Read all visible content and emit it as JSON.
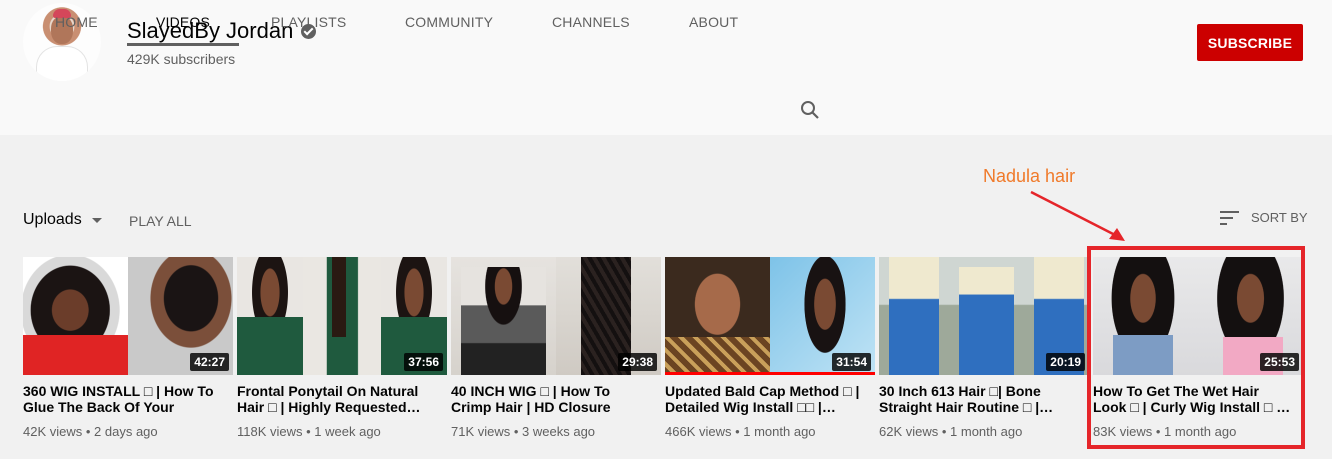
{
  "channel": {
    "name": "SlayedBy Jordan",
    "subscribers": "429K subscribers",
    "subscribe_label": "SUBSCRIBE"
  },
  "tabs": [
    {
      "label": "HOME",
      "active": false
    },
    {
      "label": "VIDEOS",
      "active": true
    },
    {
      "label": "PLAYLISTS",
      "active": false
    },
    {
      "label": "COMMUNITY",
      "active": false
    },
    {
      "label": "CHANNELS",
      "active": false
    },
    {
      "label": "ABOUT",
      "active": false
    }
  ],
  "controls": {
    "uploads_label": "Uploads",
    "play_all_label": "PLAY ALL",
    "sort_label": "SORT BY"
  },
  "annotation": {
    "label": "Nadula hair",
    "color": "#f07a2a",
    "box_color": "#e5252a"
  },
  "videos": [
    {
      "duration": "42:27",
      "title": "360 WIG INSTALL □ | How To Glue The Back Of Your Lace…",
      "views": "42K views",
      "age": "2 days ago",
      "watched": 0
    },
    {
      "duration": "37:56",
      "title": "Frontal Ponytail On Natural Hair □ | Highly Requested…",
      "views": "118K views",
      "age": "1 week ago",
      "watched": 0
    },
    {
      "duration": "29:38",
      "title": "40 INCH WIG □ | How To Crimp Hair | HD Closure Wig…",
      "views": "71K views",
      "age": "3 weeks ago",
      "watched": 0
    },
    {
      "duration": "31:54",
      "title": "Updated Bald Cap Method □ | Detailed Wig Install □□ |…",
      "views": "466K views",
      "age": "1 month ago",
      "watched": 1.0
    },
    {
      "duration": "20:19",
      "title": "30 Inch 613 Hair □| Bone Straight Hair Routine □ |…",
      "views": "62K views",
      "age": "1 month ago",
      "watched": 0
    },
    {
      "duration": "25:53",
      "title": "How To Get The Wet Hair Look □ | Curly Wig Install □ …",
      "views": "83K views",
      "age": "1 month ago",
      "watched": 0
    }
  ],
  "colors": {
    "subscribe_red": "#cc0000",
    "progress_red": "#ff0000"
  }
}
